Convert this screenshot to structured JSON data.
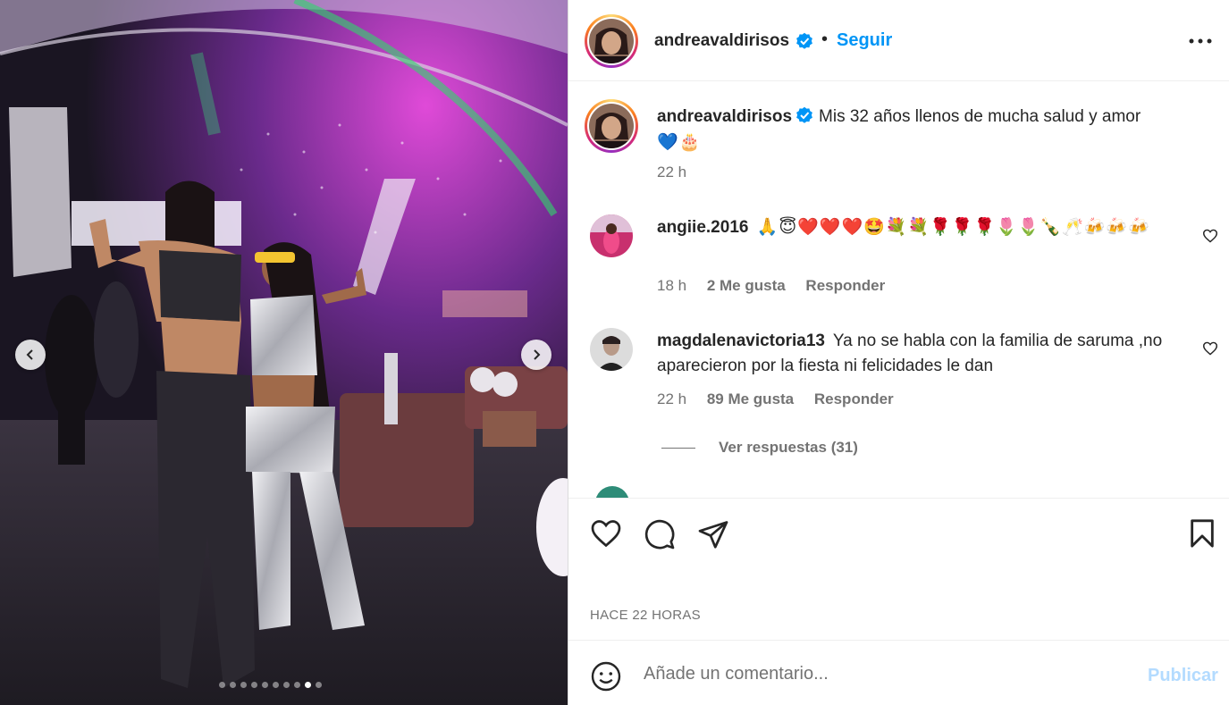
{
  "post": {
    "author": "andreavaldirisos",
    "verified_icon": "verified-badge-icon",
    "separator": "•",
    "follow_label": "Seguir",
    "caption_text": "Mis 32 años llenos de mucha salud y amor",
    "caption_emojis": "💙🎂",
    "caption_time": "22 h",
    "time_ago": "HACE 22 HORAS",
    "carousel": {
      "total": 10,
      "active_index": 8
    }
  },
  "comments": [
    {
      "user": "angiie.2016",
      "text": "🙏😇❤️❤️❤️🤩💐💐🌹🌹🌹🌷🌷🍾🥂🍻🍻🍻",
      "time": "18 h",
      "likes": "2 Me gusta",
      "reply_label": "Responder"
    },
    {
      "user": "magdalenavictoria13",
      "text": "Ya no se habla con la familia de saruma ,no aparecieron por la fiesta ni felicidades le dan",
      "time": "22 h",
      "likes": "89 Me gusta",
      "reply_label": "Responder",
      "view_replies": "Ver respuestas (31)"
    }
  ],
  "composer": {
    "placeholder": "Añade un comentario...",
    "publish_label": "Publicar"
  },
  "colors": {
    "accent": "#0095f6",
    "verified": "#0095f6",
    "muted_text": "#737373",
    "publish_disabled": "#b3dbff"
  }
}
